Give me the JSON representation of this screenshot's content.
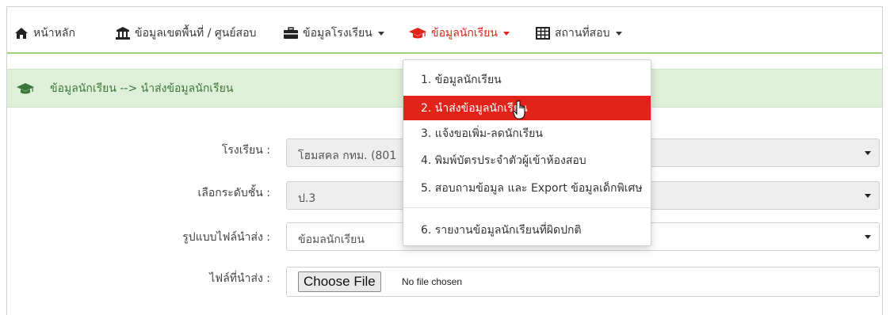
{
  "nav": {
    "items": [
      {
        "label": "หน้าหลัก",
        "icon": "home-icon",
        "dropdown": false,
        "active": false
      },
      {
        "label": "ข้อมูลเขตพื้นที่ / ศูนย์สอบ",
        "icon": "institution-icon",
        "dropdown": false,
        "active": false
      },
      {
        "label": "ข้อมูลโรงเรียน",
        "icon": "briefcase-icon",
        "dropdown": true,
        "active": false
      },
      {
        "label": "ข้อมูลนักเรียน",
        "icon": "graduation-cap-icon",
        "dropdown": true,
        "active": true
      },
      {
        "label": "สถานที่สอบ",
        "icon": "table-icon",
        "dropdown": true,
        "active": false
      }
    ]
  },
  "header": {
    "breadcrumb": "ข้อมูลนักเรียน --> นำส่งข้อมูลนักเรียน",
    "icon": "graduation-cap-icon"
  },
  "form": {
    "school_label": "โรงเรียน :",
    "school_value": "โฮมสคล กทม. (801",
    "grade_label": "เลือกระดับชั้น :",
    "grade_value": "ป.3",
    "format_label": "รูปแบบไฟล์นำส่ง :",
    "format_value": "ข้อมลนักเรียน",
    "file_label": "ไฟล์ที่นำส่ง :",
    "file_button": "Choose File",
    "file_status": "No file chosen"
  },
  "menu": {
    "items": [
      "1. ข้อมูลนักเรียน",
      "2. นำส่งข้อมูลนักเรียน",
      "3. แจ้งขอเพิ่ม-ลดนักเรียน",
      "4. พิมพ์บัตรประจำตัวผู้เข้าห้องสอบ",
      "5. สอบถามข้อมูล และ Export ข้อมูลเด็กพิเศษ",
      "6. รายงานข้อมูลนักเรียนที่ผิดปกติ"
    ],
    "active_index": 1
  },
  "colors": {
    "accent": "#e2231a",
    "header_bg": "#dff0d8",
    "header_text": "#3c763d",
    "nav_border": "#9fd17f"
  }
}
